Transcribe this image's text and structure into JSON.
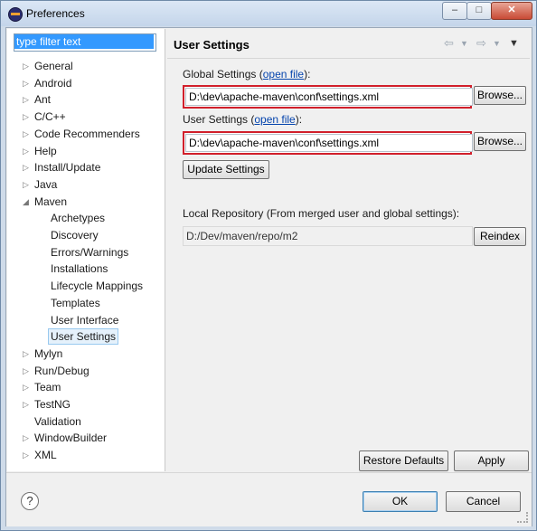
{
  "window": {
    "title": "Preferences",
    "icon": "eclipse-icon"
  },
  "filter": {
    "value": "type filter text"
  },
  "tree": {
    "items": [
      {
        "label": "General",
        "expanded": false
      },
      {
        "label": "Android",
        "expanded": false
      },
      {
        "label": "Ant",
        "expanded": false
      },
      {
        "label": "C/C++",
        "expanded": false
      },
      {
        "label": "Code Recommenders",
        "expanded": false
      },
      {
        "label": "Help",
        "expanded": false
      },
      {
        "label": "Install/Update",
        "expanded": false
      },
      {
        "label": "Java",
        "expanded": false
      },
      {
        "label": "Maven",
        "expanded": true
      },
      {
        "label": "Archetypes"
      },
      {
        "label": "Discovery"
      },
      {
        "label": "Errors/Warnings"
      },
      {
        "label": "Installations"
      },
      {
        "label": "Lifecycle Mappings"
      },
      {
        "label": "Templates"
      },
      {
        "label": "User Interface"
      },
      {
        "label": "User Settings",
        "selected": true
      },
      {
        "label": "Mylyn",
        "expanded": false
      },
      {
        "label": "Run/Debug",
        "expanded": false
      },
      {
        "label": "Team",
        "expanded": false
      },
      {
        "label": "TestNG",
        "expanded": false
      },
      {
        "label": "Validation"
      },
      {
        "label": "WindowBuilder",
        "expanded": false
      },
      {
        "label": "XML",
        "expanded": false
      }
    ]
  },
  "page": {
    "title": "User Settings",
    "global": {
      "label_prefix": "Global Settings (",
      "link": "open file",
      "label_suffix": "):",
      "value": "D:\\dev\\apache-maven\\conf\\settings.xml",
      "browse": "Browse..."
    },
    "user": {
      "label_prefix": "User Settings (",
      "link": "open file",
      "label_suffix": "):",
      "value": "D:\\dev\\apache-maven\\conf\\settings.xml",
      "browse": "Browse..."
    },
    "update_button": "Update Settings",
    "local_repo_label": "Local Repository (From merged user and global settings):",
    "local_repo_value": "D:/Dev/maven/repo/m2",
    "reindex_button": "Reindex",
    "restore_defaults": "Restore Defaults",
    "apply": "Apply"
  },
  "footer": {
    "help": "?",
    "ok": "OK",
    "cancel": "Cancel"
  },
  "colors": {
    "highlight_border": "#d11f2b",
    "link": "#0645ad",
    "filter_selection": "#3399ff"
  }
}
